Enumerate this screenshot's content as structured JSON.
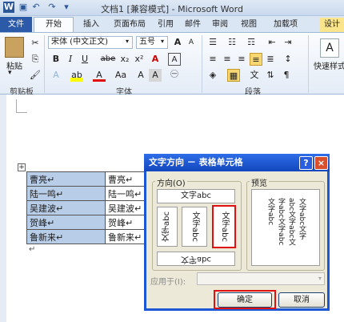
{
  "window": {
    "title": "文档1 [兼容模式] - Microsoft Word"
  },
  "tabs": [
    "文件",
    "开始",
    "插入",
    "页面布局",
    "引用",
    "邮件",
    "审阅",
    "视图",
    "加载项"
  ],
  "tab_partial": "设计",
  "ribbon": {
    "paste_label": "粘贴",
    "font_name": "宋体 (中文正文)",
    "font_size": "五号",
    "bold": "B",
    "italic": "I",
    "underline": "U",
    "abc": "abe",
    "x2": "x₂",
    "x2sup": "x²",
    "font_a": "A",
    "aa": "Aa",
    "quick_style_label": "快速样式",
    "groups": {
      "clipboard": "剪贴板",
      "font": "字体",
      "paragraph": "段落"
    }
  },
  "table": {
    "col1": [
      "曹亮↵",
      "陆一鸣↵",
      "吴建波↵",
      "贺峰↵",
      "鲁新来↵"
    ],
    "col2": [
      "曹亮↵",
      "陆一鸣↵",
      "吴建波↵",
      "贺峰↵",
      "鲁新来↵"
    ]
  },
  "para_mark": "↵",
  "dialog": {
    "title": "文字方向 － 表格单元格",
    "help": "?",
    "close": "×",
    "direction_label": "方向(O)",
    "preview_label": "预览",
    "opt_horizontal": "文字abc",
    "opt_v1": "文字abc",
    "opt_v2": "文字abc",
    "opt_v3": "文字abc",
    "opt_rot": "文字abc",
    "preview_text": "文字abc文字abc文字abc文字abc文字abc文字abc",
    "apply_label": "应用于(I):",
    "ok": "确定",
    "cancel": "取消"
  }
}
